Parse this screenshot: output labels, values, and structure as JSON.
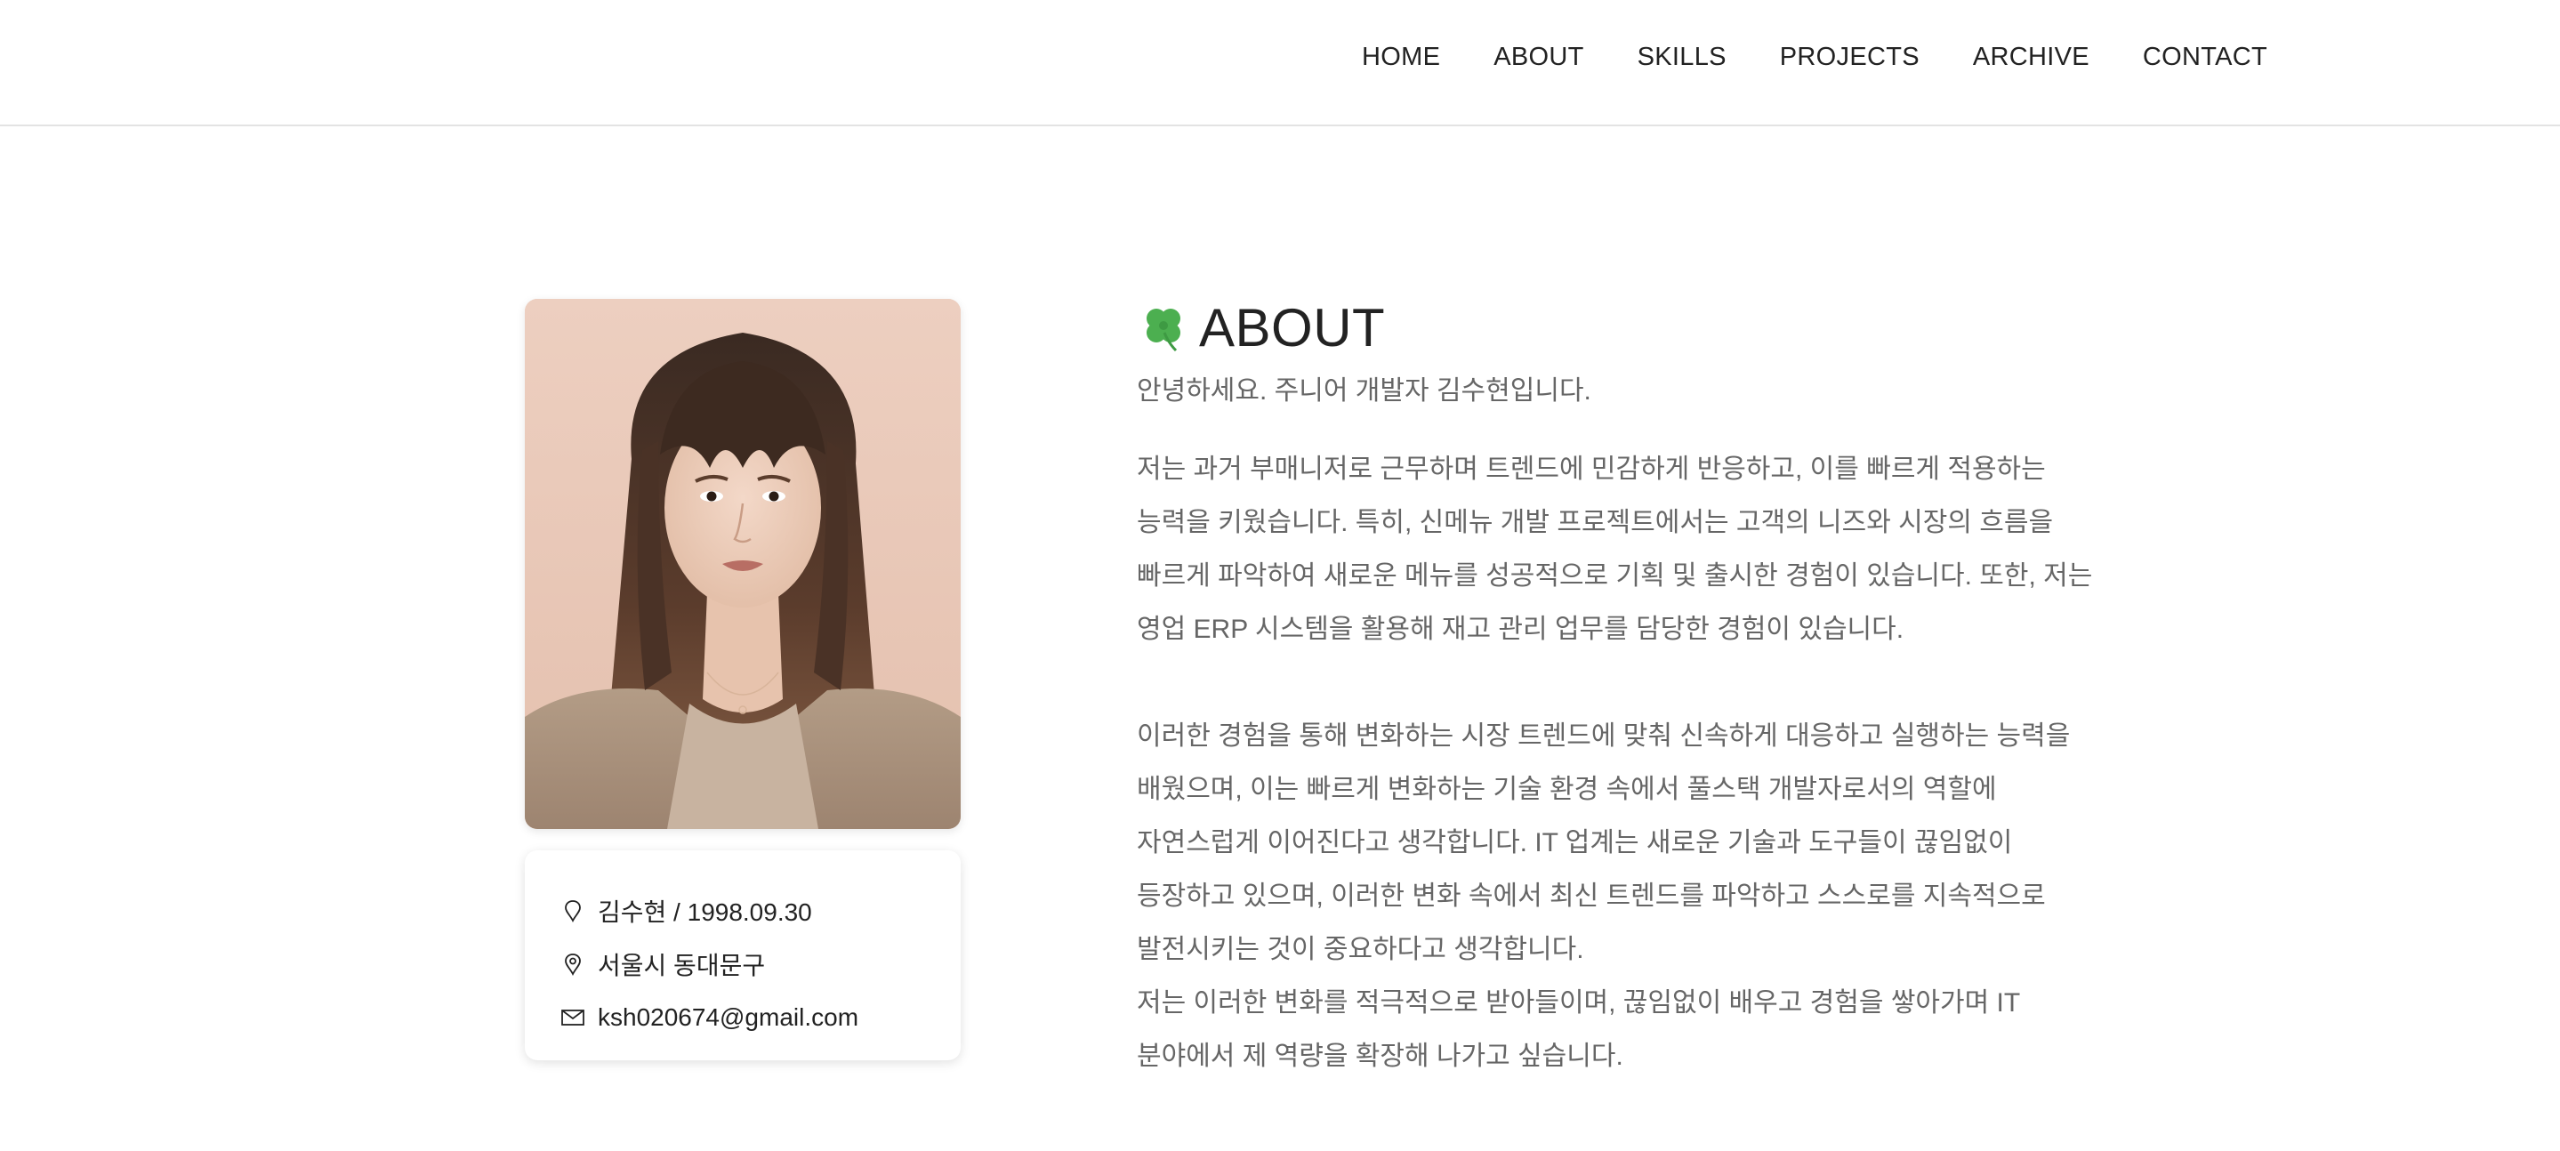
{
  "nav": {
    "items": [
      "HOME",
      "ABOUT",
      "SKILLS",
      "PROJECTS",
      "ARCHIVE",
      "CONTACT"
    ]
  },
  "profile": {
    "photo_alt": "profile photo",
    "name_birth": "김수현 / 1998.09.30",
    "location": "서울시 동대문구",
    "email": "ksh020674@gmail.com",
    "icons": [
      "pin-icon",
      "location-icon",
      "mail-icon"
    ]
  },
  "about": {
    "emoji_icon": "clover-icon",
    "title": "ABOUT",
    "intro": "안녕하세요. 주니어 개발자 김수현입니다.",
    "paragraph1": "저는 과거 부매니저로 근무하며 트렌드에 민감하게 반응하고, 이를 빠르게 적용하는 능력을 키웠습니다. 특히, 신메뉴 개발 프로젝트에서는 고객의 니즈와 시장의 흐름을 빠르게 파악하여 새로운 메뉴를 성공적으로 기획 및 출시한 경험이 있습니다. 또한, 저는 영업 ERP 시스템을 활용해 재고 관리 업무를 담당한 경험이 있습니다.",
    "paragraph2": "이러한 경험을 통해 변화하는 시장 트렌드에 맞춰 신속하게 대응하고 실행하는 능력을 배웠으며, 이는 빠르게 변화하는 기술 환경 속에서 풀스택 개발자로서의 역할에 자연스럽게 이어진다고 생각합니다. IT 업계는 새로운 기술과 도구들이 끊임없이 등장하고 있으며, 이러한 변화 속에서 최신 트렌드를 파악하고 스스로를 지속적으로 발전시키는 것이 중요하다고 생각합니다.",
    "paragraph3": "저는 이러한 변화를 적극적으로 받아들이며, 끊임없이 배우고 경험을 쌓아가며 IT 분야에서 제 역량을 확장해 나가고 싶습니다."
  },
  "colors": {
    "text_dark": "#222222",
    "text_muted": "#666666",
    "divider": "#e3e3e3",
    "clover_green": "#4caf50"
  }
}
